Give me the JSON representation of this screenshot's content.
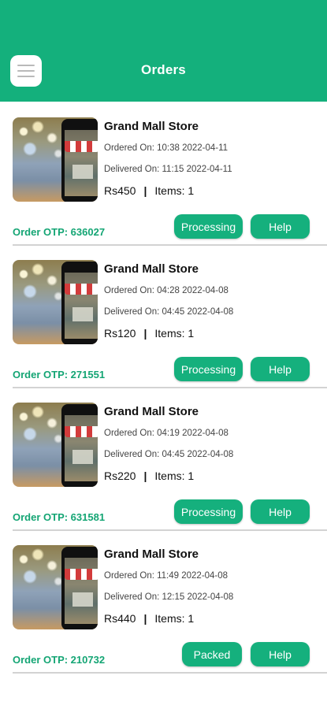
{
  "header": {
    "title": "Orders",
    "menu_icon": "hamburger-menu-icon",
    "background_color": "#14b07c"
  },
  "orders": [
    {
      "store_name": "Grand Mall Store",
      "ordered_on": "Ordered On: 10:38 2022-04-11",
      "delivered_on": "Delivered On: 11:15 2022-04-11",
      "price": "Rs450",
      "items": "Items: 1",
      "otp": "Order OTP: 636027",
      "status_label": "Processing",
      "help_label": "Help"
    },
    {
      "store_name": "Grand Mall Store",
      "ordered_on": "Ordered On: 04:28 2022-04-08",
      "delivered_on": "Delivered On: 04:45 2022-04-08",
      "price": "Rs120",
      "items": "Items: 1",
      "otp": "Order OTP: 271551",
      "status_label": "Processing",
      "help_label": "Help"
    },
    {
      "store_name": "Grand Mall Store",
      "ordered_on": "Ordered On: 04:19 2022-04-08",
      "delivered_on": "Delivered On: 04:45 2022-04-08",
      "price": "Rs220",
      "items": "Items: 1",
      "otp": "Order OTP: 631581",
      "status_label": "Processing",
      "help_label": "Help"
    },
    {
      "store_name": "Grand Mall Store",
      "ordered_on": "Ordered On: 11:49 2022-04-08",
      "delivered_on": "Delivered On: 12:15 2022-04-08",
      "price": "Rs440",
      "items": "Items: 1",
      "otp": "Order OTP: 210732",
      "status_label": "Packed",
      "help_label": "Help"
    }
  ],
  "separator": "|",
  "accent_color": "#15b07d"
}
